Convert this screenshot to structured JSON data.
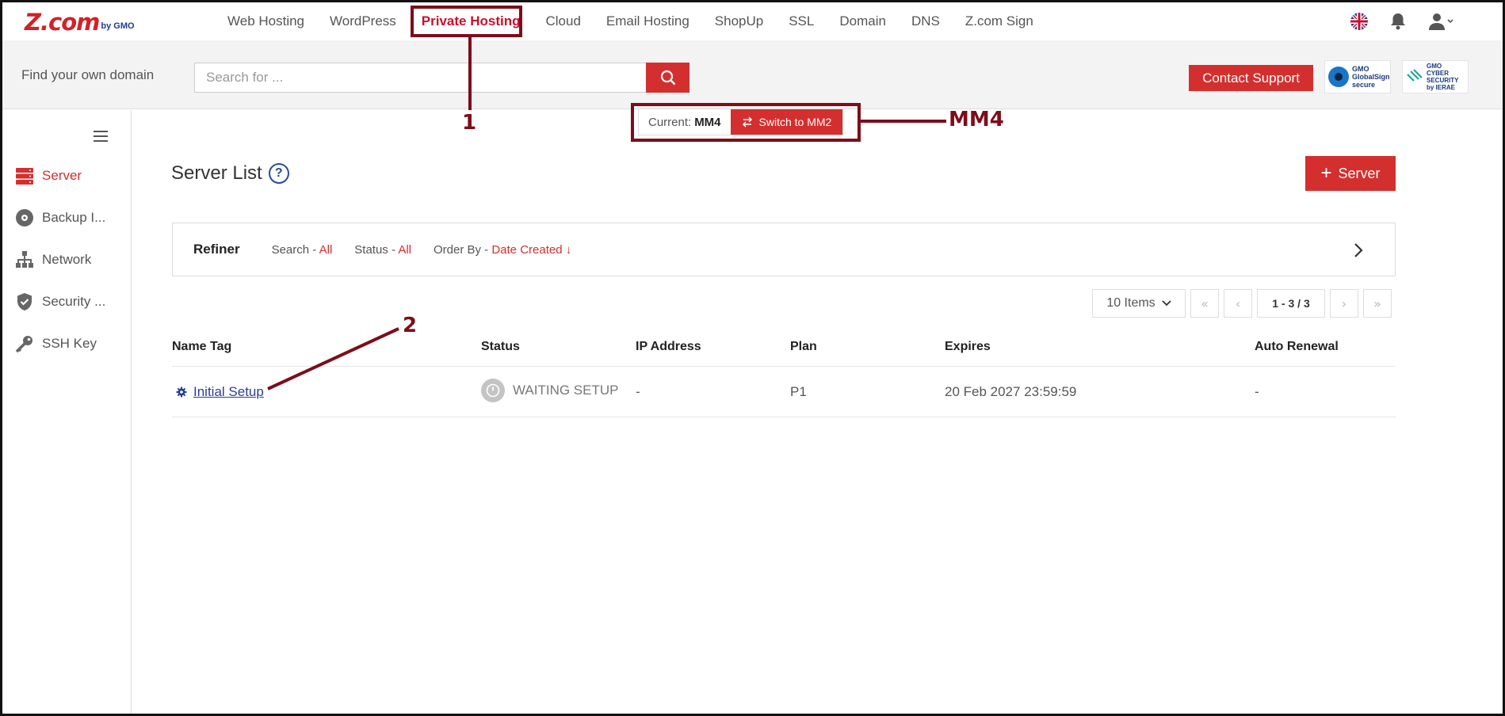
{
  "nav": {
    "logo_main": "Z.com",
    "logo_sub": "by GMO",
    "items": [
      "Web Hosting",
      "WordPress",
      "Private Hosting",
      "Cloud",
      "Email Hosting",
      "ShopUp",
      "SSL",
      "Domain",
      "DNS",
      "Z.com Sign"
    ],
    "active_index": 2
  },
  "search": {
    "label": "Find your own domain",
    "placeholder": "Search for ...",
    "contact_label": "Contact Support",
    "badge1_line1": "GMO",
    "badge1_line2": "GlobalSign",
    "badge1_line3": "secure",
    "badge2_line1": "GMO",
    "badge2_line2": "CYBER SECURITY",
    "badge2_line3": "by IERAE"
  },
  "mm": {
    "current_label": "Current:",
    "current_value": "MM4",
    "switch_label": "Switch to MM2"
  },
  "sidebar": {
    "items": [
      {
        "label": "Server",
        "icon": "server-icon"
      },
      {
        "label": "Backup I...",
        "icon": "backup-icon"
      },
      {
        "label": "Network",
        "icon": "network-icon"
      },
      {
        "label": "Security ...",
        "icon": "shield-icon"
      },
      {
        "label": "SSH Key",
        "icon": "key-icon"
      }
    ]
  },
  "main": {
    "title": "Server List",
    "help": "?",
    "add_label": "Server"
  },
  "refiner": {
    "title": "Refiner",
    "search_label": "Search - ",
    "search_value": "All",
    "status_label": "Status - ",
    "status_value": "All",
    "order_label": "Order By - ",
    "order_value": "Date Created ↓"
  },
  "pager": {
    "per_page": "10 Items",
    "range": "1 - 3 / 3"
  },
  "table": {
    "columns": [
      "Name Tag",
      "Status",
      "IP Address",
      "Plan",
      "Expires",
      "Auto Renewal"
    ],
    "rows": [
      {
        "name": "Initial Setup",
        "status": "WAITING SETUP",
        "ip": "-",
        "plan": "P1",
        "expires": "20 Feb 2027 23:59:59",
        "renewal": "-"
      }
    ]
  },
  "annotations": {
    "a1": "1",
    "a2": "2",
    "a3": "MM4"
  },
  "colors": {
    "accent": "#d32f2f",
    "annotation": "#7d0d1a",
    "link": "#2b3e8f"
  }
}
